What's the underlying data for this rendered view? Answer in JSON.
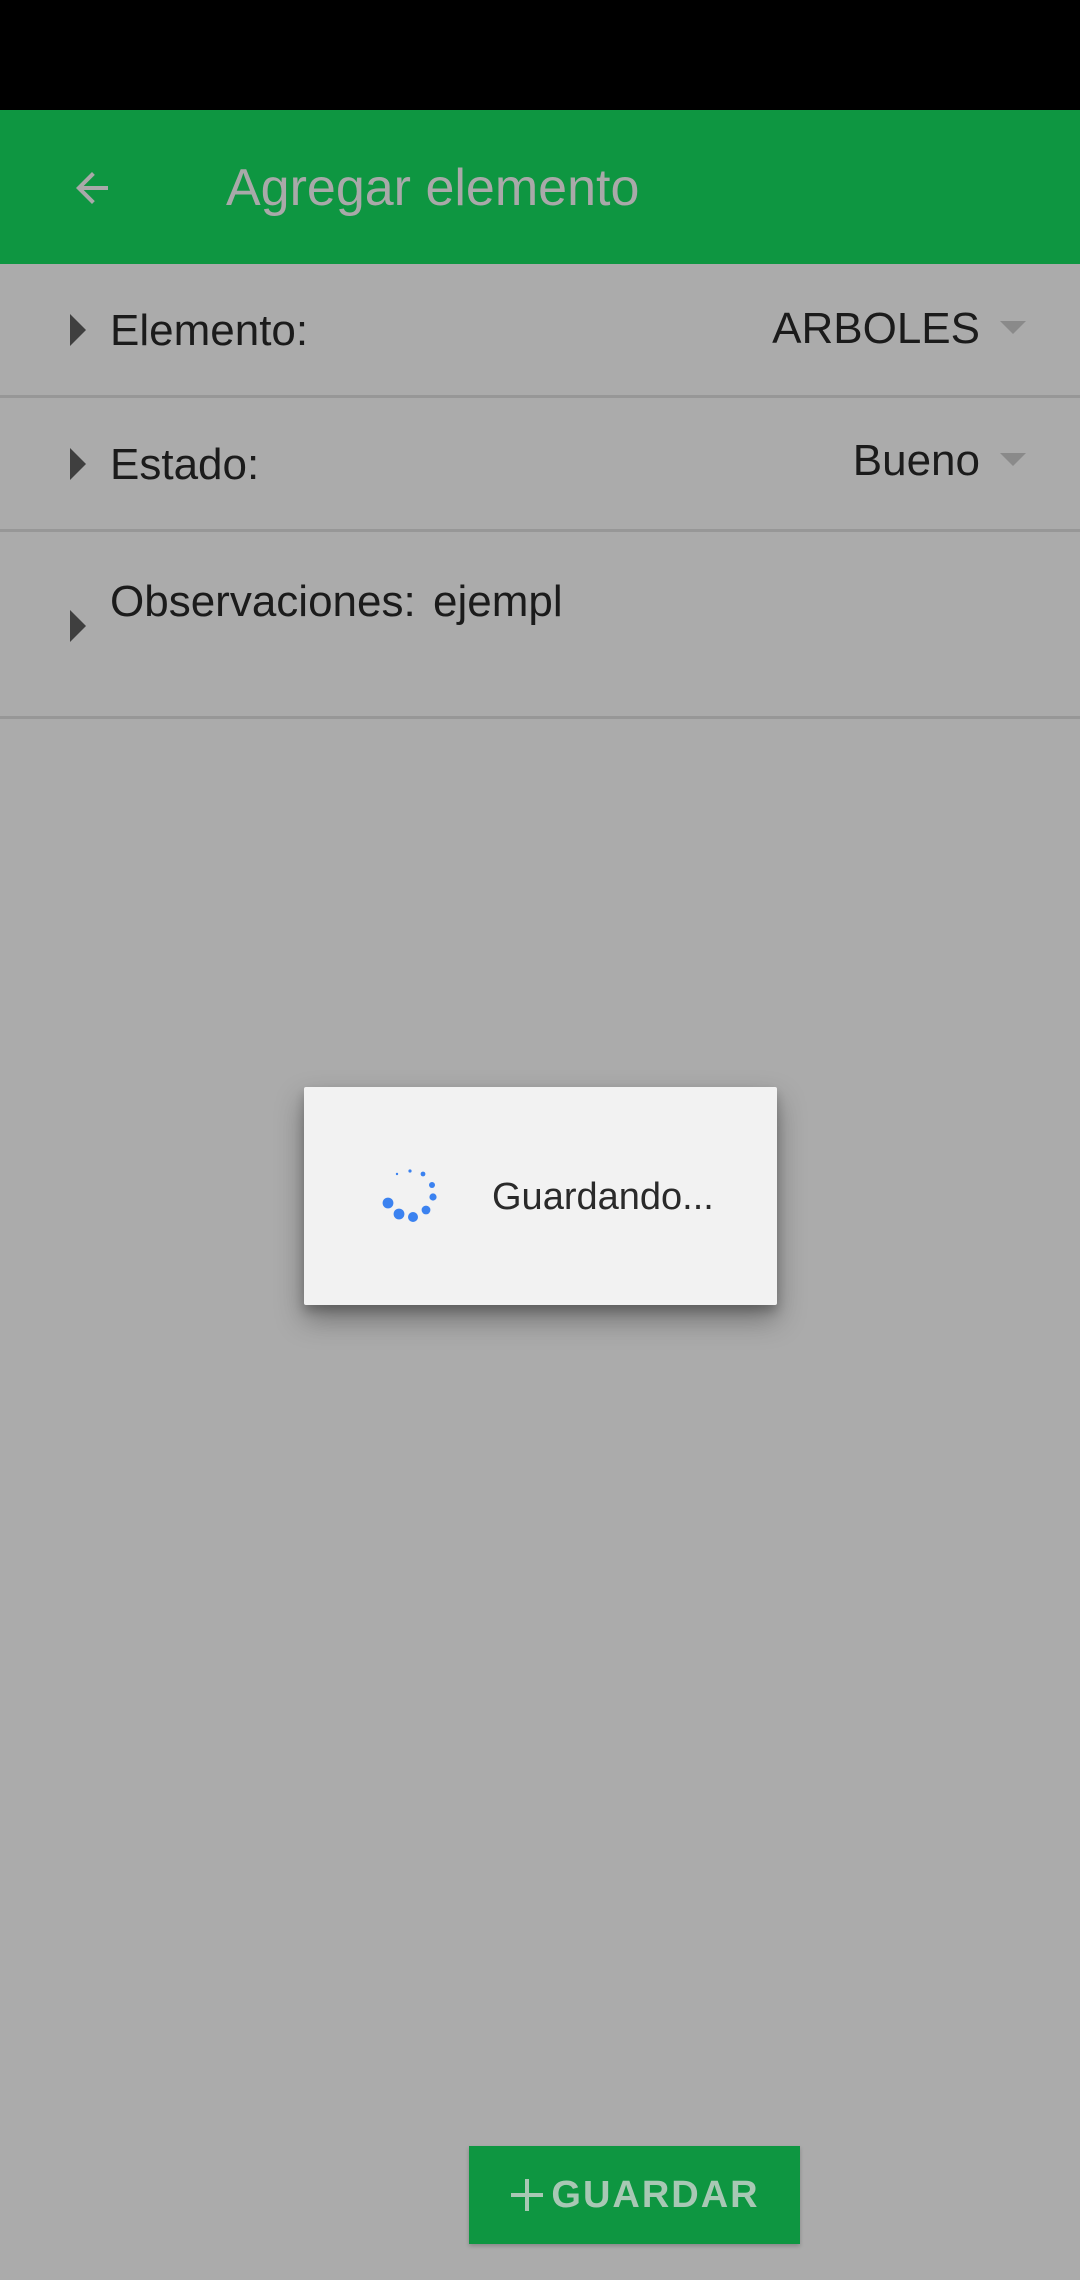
{
  "app_bar": {
    "title": "Agregar elemento",
    "back_icon": "arrow-back-icon",
    "background": "#0e9641"
  },
  "form": {
    "rows": [
      {
        "label": "Elemento:",
        "value": "ARBOLES"
      },
      {
        "label": "Estado:",
        "value": "Bueno"
      },
      {
        "label": "Observaciones:",
        "value": "ejempl"
      }
    ]
  },
  "dialog": {
    "message": "Guardando...",
    "spinner_color": "#3b82f0"
  },
  "save_button": {
    "label": "GUARDAR",
    "icon": "plus-icon"
  }
}
